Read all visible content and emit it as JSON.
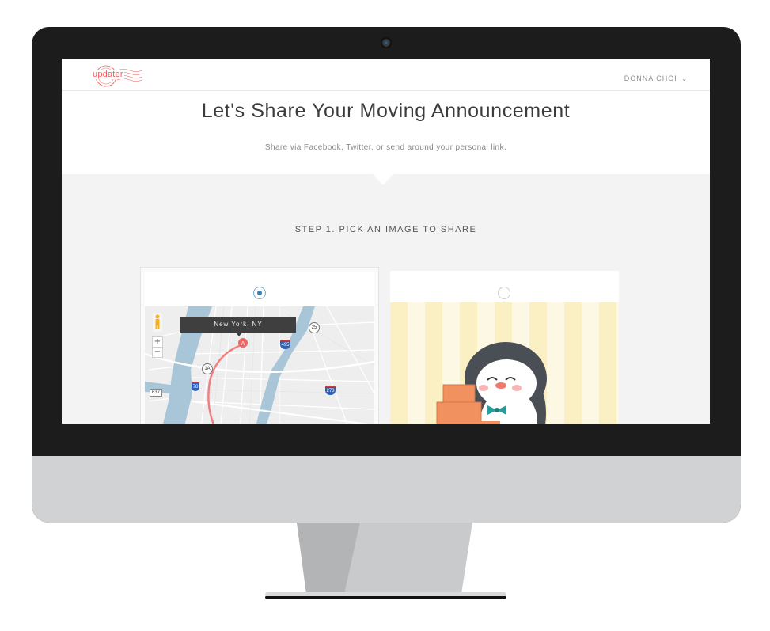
{
  "app": {
    "logo_text": "updater",
    "user_name": "DONNA CHOI",
    "user_chevron": "⌄"
  },
  "page": {
    "title": "Let's Share Your Moving Announcement",
    "subtitle": "Share via Facebook, Twitter, or send around your personal link."
  },
  "step1": {
    "label": "STEP 1. PICK AN IMAGE TO SHARE",
    "options": [
      {
        "type": "map",
        "selected": true,
        "location_label": "New York, NY",
        "marker_letter": "A",
        "zoom_in": "+",
        "zoom_out": "−",
        "road_labels": [
          "637",
          "25",
          "495",
          "278",
          "78",
          "1A"
        ]
      },
      {
        "type": "penguin-illustration",
        "selected": false
      }
    ]
  },
  "colors": {
    "brand": "#ee5a5a",
    "radio_selected": "#3d7fae",
    "water": "#a9c6d8",
    "route": "#f08080"
  }
}
